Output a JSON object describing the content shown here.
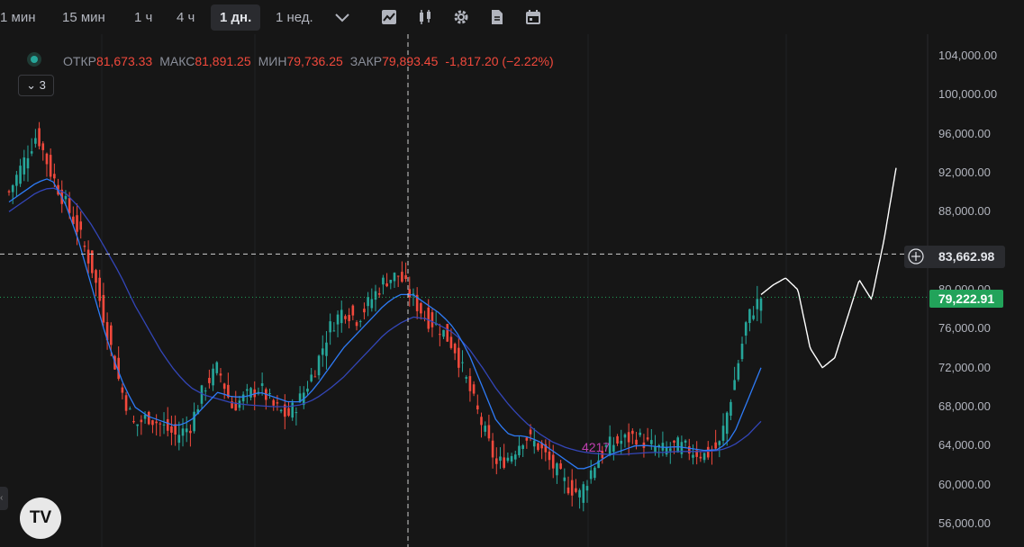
{
  "toolbar": {
    "timeframes": [
      {
        "label": "1 мин",
        "active": false
      },
      {
        "label": "15 мин",
        "active": false
      },
      {
        "label": "1 ч",
        "active": false
      },
      {
        "label": "4 ч",
        "active": false
      },
      {
        "label": "1 дн.",
        "active": true
      },
      {
        "label": "1 нед.",
        "active": false
      }
    ],
    "icons": [
      "chevron-down-icon",
      "chart-type-icon",
      "candlestick-icon",
      "settings-gear-icon",
      "document-icon",
      "calendar-icon"
    ]
  },
  "legend": {
    "open_label": "ОТКР",
    "open_value": "81,673.33",
    "high_label": "МАКС",
    "high_value": "81,891.25",
    "low_label": "МИН",
    "low_value": "79,736.25",
    "close_label": "ЗАКР",
    "close_value": "79,893.45",
    "change": "-1,817.20 (−2.22%)",
    "collapse_label": "3"
  },
  "price_axis": {
    "labels": [
      "104,000.00",
      "100,000.00",
      "96,000.00",
      "92,000.00",
      "88,000.00",
      "84,000.00",
      "80,000.00",
      "76,000.00",
      "72,000.00",
      "68,000.00",
      "64,000.00",
      "60,000.00",
      "56,000.00"
    ],
    "crosshair_price": "83,662.98",
    "current_price": "79,222.91"
  },
  "overlay_text": "4217",
  "logo_text": "TV",
  "side_tab_label": "‹",
  "colors": {
    "background": "#161616",
    "up": "#26a69a",
    "down": "#f2493c",
    "ma_fast": "#2e7bf6",
    "ma_slow": "#3346b8",
    "current_tag": "#22a35a",
    "drawing": "#ffffff"
  },
  "chart_data": {
    "type": "candlestick",
    "ylim": [
      55000,
      106000
    ],
    "y_ticks": [
      104000,
      100000,
      96000,
      92000,
      88000,
      84000,
      80000,
      76000,
      72000,
      68000,
      64000,
      60000,
      56000
    ],
    "crosshair_value": 83662.98,
    "current_value": 79222.91,
    "close_path": [
      90000,
      93000,
      96000,
      92000,
      89000,
      86000,
      82000,
      76000,
      70000,
      66000,
      67000,
      66000,
      65000,
      66000,
      70000,
      72000,
      68000,
      69000,
      70000,
      68000,
      67000,
      69000,
      72000,
      76000,
      78000,
      77000,
      79000,
      81000,
      81500,
      79000,
      77000,
      76000,
      74000,
      70000,
      66000,
      62000,
      63000,
      65000,
      64000,
      62000,
      60000,
      59000,
      62000,
      64000,
      64500,
      65000,
      64000,
      63500,
      64000,
      63500,
      63000,
      64000,
      70000,
      77000,
      79222.91
    ],
    "ma_fast_path": [
      89000,
      90000,
      91000,
      91500,
      89000,
      85000,
      80000,
      75000,
      71000,
      68000,
      67000,
      66500,
      66000,
      66500,
      68000,
      69500,
      69000,
      69000,
      69500,
      69000,
      68500,
      68500,
      70000,
      72000,
      74000,
      75500,
      77000,
      78500,
      79500,
      79500,
      78500,
      77500,
      76000,
      73500,
      70000,
      66500,
      65000,
      65000,
      64500,
      63500,
      62500,
      61500,
      62000,
      63000,
      63500,
      64000,
      64000,
      63800,
      63900,
      63700,
      63500,
      63600,
      65000,
      68500,
      72000
    ],
    "ma_slow_path": [
      88000,
      89000,
      90000,
      90500,
      90000,
      88500,
      86500,
      84000,
      81500,
      78500,
      76000,
      73500,
      71500,
      70000,
      69200,
      68800,
      68400,
      68200,
      68100,
      68000,
      68000,
      68200,
      68800,
      69800,
      71000,
      72500,
      74000,
      75500,
      76500,
      77200,
      77000,
      76300,
      75500,
      74000,
      72000,
      69800,
      68000,
      66500,
      65300,
      64400,
      63800,
      63400,
      63200,
      63100,
      63100,
      63200,
      63300,
      63300,
      63400,
      63400,
      63400,
      63500,
      64000,
      65000,
      66500
    ],
    "projection_path": [
      79500,
      80500,
      81200,
      80000,
      74000,
      72000,
      73000,
      77000,
      81000,
      79000,
      85000,
      92500
    ]
  }
}
